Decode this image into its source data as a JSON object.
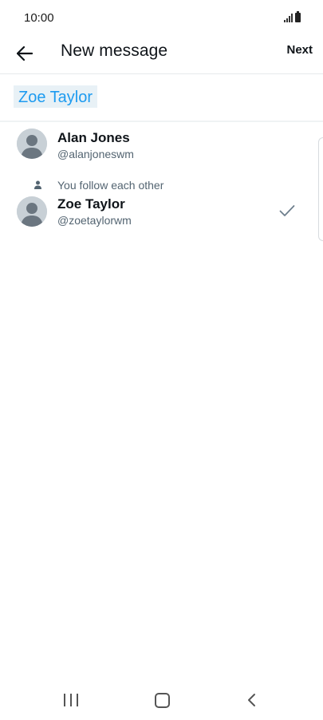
{
  "status_bar": {
    "time": "10:00"
  },
  "header": {
    "back_icon": "arrow-left-icon",
    "title": "New message",
    "next_label": "Next"
  },
  "recipient": {
    "chip_label": "Zoe Taylor"
  },
  "results": [
    {
      "name": "Alan Jones",
      "handle": "@alanjoneswm",
      "selected": false
    },
    {
      "follow_note": "You follow each other",
      "name": "Zoe Taylor",
      "handle": "@zoetaylorwm",
      "selected": true
    }
  ],
  "colors": {
    "accent": "#1d9bf0",
    "chip_bg": "#e8f1f6",
    "secondary_text": "#536471",
    "avatar_bg": "#c8d0d6"
  }
}
